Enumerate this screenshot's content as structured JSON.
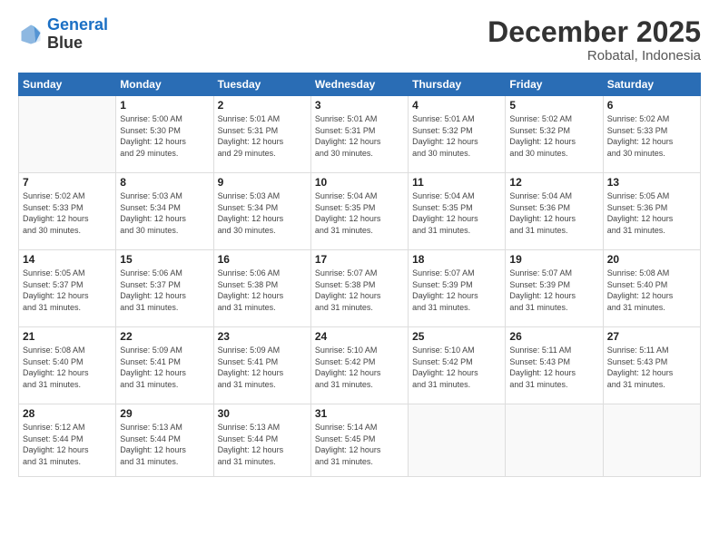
{
  "header": {
    "logo_line1": "General",
    "logo_line2": "Blue",
    "title": "December 2025",
    "subtitle": "Robatal, Indonesia"
  },
  "columns": [
    "Sunday",
    "Monday",
    "Tuesday",
    "Wednesday",
    "Thursday",
    "Friday",
    "Saturday"
  ],
  "weeks": [
    [
      {
        "day": "",
        "info": ""
      },
      {
        "day": "1",
        "info": "Sunrise: 5:00 AM\nSunset: 5:30 PM\nDaylight: 12 hours\nand 29 minutes."
      },
      {
        "day": "2",
        "info": "Sunrise: 5:01 AM\nSunset: 5:31 PM\nDaylight: 12 hours\nand 29 minutes."
      },
      {
        "day": "3",
        "info": "Sunrise: 5:01 AM\nSunset: 5:31 PM\nDaylight: 12 hours\nand 30 minutes."
      },
      {
        "day": "4",
        "info": "Sunrise: 5:01 AM\nSunset: 5:32 PM\nDaylight: 12 hours\nand 30 minutes."
      },
      {
        "day": "5",
        "info": "Sunrise: 5:02 AM\nSunset: 5:32 PM\nDaylight: 12 hours\nand 30 minutes."
      },
      {
        "day": "6",
        "info": "Sunrise: 5:02 AM\nSunset: 5:33 PM\nDaylight: 12 hours\nand 30 minutes."
      }
    ],
    [
      {
        "day": "7",
        "info": "Sunrise: 5:02 AM\nSunset: 5:33 PM\nDaylight: 12 hours\nand 30 minutes."
      },
      {
        "day": "8",
        "info": "Sunrise: 5:03 AM\nSunset: 5:34 PM\nDaylight: 12 hours\nand 30 minutes."
      },
      {
        "day": "9",
        "info": "Sunrise: 5:03 AM\nSunset: 5:34 PM\nDaylight: 12 hours\nand 30 minutes."
      },
      {
        "day": "10",
        "info": "Sunrise: 5:04 AM\nSunset: 5:35 PM\nDaylight: 12 hours\nand 31 minutes."
      },
      {
        "day": "11",
        "info": "Sunrise: 5:04 AM\nSunset: 5:35 PM\nDaylight: 12 hours\nand 31 minutes."
      },
      {
        "day": "12",
        "info": "Sunrise: 5:04 AM\nSunset: 5:36 PM\nDaylight: 12 hours\nand 31 minutes."
      },
      {
        "day": "13",
        "info": "Sunrise: 5:05 AM\nSunset: 5:36 PM\nDaylight: 12 hours\nand 31 minutes."
      }
    ],
    [
      {
        "day": "14",
        "info": "Sunrise: 5:05 AM\nSunset: 5:37 PM\nDaylight: 12 hours\nand 31 minutes."
      },
      {
        "day": "15",
        "info": "Sunrise: 5:06 AM\nSunset: 5:37 PM\nDaylight: 12 hours\nand 31 minutes."
      },
      {
        "day": "16",
        "info": "Sunrise: 5:06 AM\nSunset: 5:38 PM\nDaylight: 12 hours\nand 31 minutes."
      },
      {
        "day": "17",
        "info": "Sunrise: 5:07 AM\nSunset: 5:38 PM\nDaylight: 12 hours\nand 31 minutes."
      },
      {
        "day": "18",
        "info": "Sunrise: 5:07 AM\nSunset: 5:39 PM\nDaylight: 12 hours\nand 31 minutes."
      },
      {
        "day": "19",
        "info": "Sunrise: 5:07 AM\nSunset: 5:39 PM\nDaylight: 12 hours\nand 31 minutes."
      },
      {
        "day": "20",
        "info": "Sunrise: 5:08 AM\nSunset: 5:40 PM\nDaylight: 12 hours\nand 31 minutes."
      }
    ],
    [
      {
        "day": "21",
        "info": "Sunrise: 5:08 AM\nSunset: 5:40 PM\nDaylight: 12 hours\nand 31 minutes."
      },
      {
        "day": "22",
        "info": "Sunrise: 5:09 AM\nSunset: 5:41 PM\nDaylight: 12 hours\nand 31 minutes."
      },
      {
        "day": "23",
        "info": "Sunrise: 5:09 AM\nSunset: 5:41 PM\nDaylight: 12 hours\nand 31 minutes."
      },
      {
        "day": "24",
        "info": "Sunrise: 5:10 AM\nSunset: 5:42 PM\nDaylight: 12 hours\nand 31 minutes."
      },
      {
        "day": "25",
        "info": "Sunrise: 5:10 AM\nSunset: 5:42 PM\nDaylight: 12 hours\nand 31 minutes."
      },
      {
        "day": "26",
        "info": "Sunrise: 5:11 AM\nSunset: 5:43 PM\nDaylight: 12 hours\nand 31 minutes."
      },
      {
        "day": "27",
        "info": "Sunrise: 5:11 AM\nSunset: 5:43 PM\nDaylight: 12 hours\nand 31 minutes."
      }
    ],
    [
      {
        "day": "28",
        "info": "Sunrise: 5:12 AM\nSunset: 5:44 PM\nDaylight: 12 hours\nand 31 minutes."
      },
      {
        "day": "29",
        "info": "Sunrise: 5:13 AM\nSunset: 5:44 PM\nDaylight: 12 hours\nand 31 minutes."
      },
      {
        "day": "30",
        "info": "Sunrise: 5:13 AM\nSunset: 5:44 PM\nDaylight: 12 hours\nand 31 minutes."
      },
      {
        "day": "31",
        "info": "Sunrise: 5:14 AM\nSunset: 5:45 PM\nDaylight: 12 hours\nand 31 minutes."
      },
      {
        "day": "",
        "info": ""
      },
      {
        "day": "",
        "info": ""
      },
      {
        "day": "",
        "info": ""
      }
    ]
  ]
}
